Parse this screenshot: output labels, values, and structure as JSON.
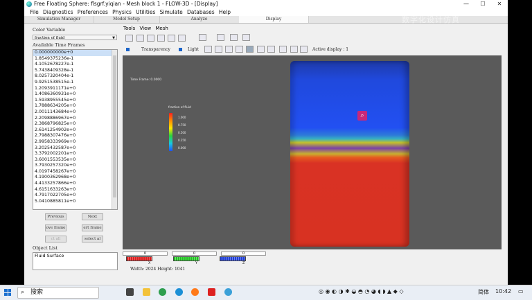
{
  "window": {
    "title": "Free Floating Sphere: flsgrf.yiqian - Mesh block 1 - FLOW-3D - [Display]",
    "minimize": "—",
    "maximize": "☐",
    "close": "✕"
  },
  "menu": [
    "File",
    "Diagnostics",
    "Preferences",
    "Physics",
    "Utilities",
    "Simulate",
    "Databases",
    "Help"
  ],
  "tabs": [
    "Simulation Manager",
    "Model Setup",
    "Analyze",
    "Display"
  ],
  "left": {
    "color_variable_label": "Color Variable",
    "color_variable_value": "fraction of fluid",
    "time_frames_label": "Available Time Frames",
    "time_frames": [
      "0.000000000e+0",
      "1.8549375236e-1",
      "4.1052678227e-1",
      "5.7438409328e-1",
      "8.0257320404e-1",
      "9.9251538515e-1",
      "1.2093911171e+0",
      "1.4086360931e+0",
      "1.5938955545e+0",
      "1.7888634205e+0",
      "2.0011143684e+0",
      "2.2098886967e+0",
      "2.3868796825e+0",
      "2.6141254902e+0",
      "2.7988307476e+0",
      "2.9958333969e+0",
      "3.2025432587e+0",
      "3.3792002201e+0",
      "3.6001553535e+0",
      "3.7930257320e+0",
      "4.0197458267e+0",
      "4.1900362968e+0",
      "4.4133257866e+0",
      "4.6151633263e+0",
      "4.7917022705e+0",
      "5.0410885811e+0"
    ],
    "previous": "Previous",
    "next": "Next",
    "move_frame": "ove frame",
    "insert_frame": "ert frame",
    "select_all": "ct all",
    "deselect_all": "select al",
    "object_list_label": "Object List",
    "objects": [
      "Fluid Surface"
    ]
  },
  "right": {
    "menu": [
      "Tools",
      "View",
      "Mesh"
    ],
    "transparency": "Transparency",
    "light": "Light",
    "active_display": "Active display : 1",
    "time_frame": "Time Frame:  0.0000",
    "legend_title": "fraction of fluid",
    "legend_ticks": [
      "1.000",
      "0.750",
      "0.500",
      "0.250",
      "0.000"
    ],
    "axes": [
      {
        "name": "X",
        "value": "0",
        "color": "#d92020"
      },
      {
        "name": "Y",
        "value": "0",
        "color": "#22c022"
      },
      {
        "name": "Z",
        "value": "0",
        "color": "#2040d0"
      }
    ],
    "size_text": "Width: 2024 Height: 1041"
  },
  "watermark": "数字化设计仿真",
  "taskbar": {
    "search": "搜索",
    "ime": "简体",
    "time": "10:42"
  }
}
